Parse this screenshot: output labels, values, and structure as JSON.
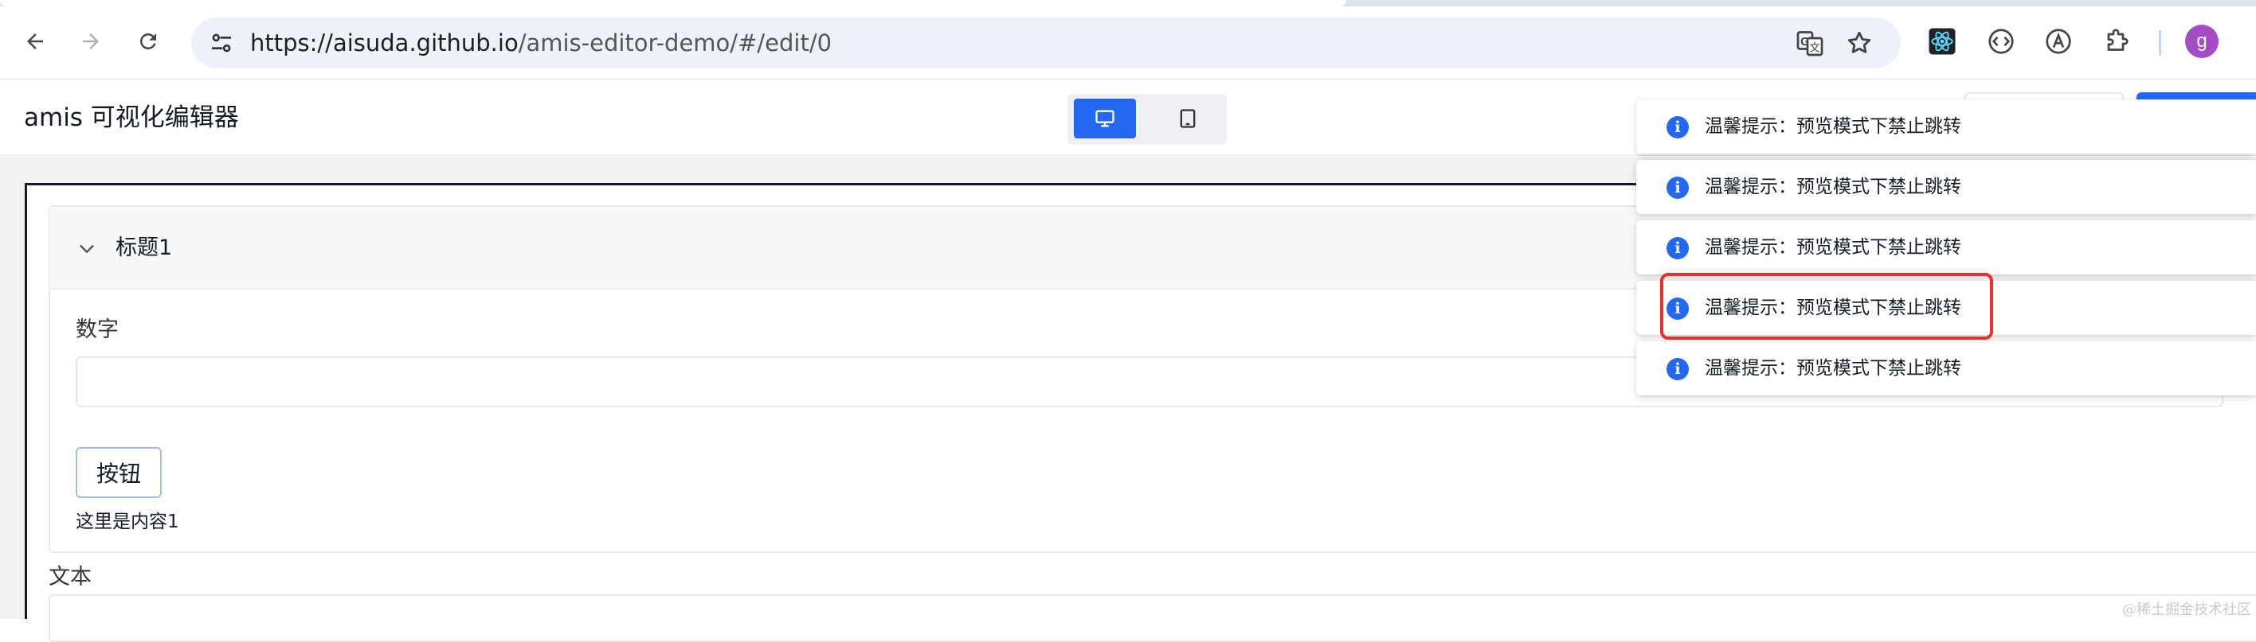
{
  "browser": {
    "url_host": "https://aisuda.github.io",
    "url_path": "/amis-editor-demo/#/edit/0",
    "avatar_letter": "g",
    "icons": [
      "back-icon",
      "forward-icon",
      "reload-icon",
      "site-info-icon",
      "translate-icon",
      "star-icon",
      "react-devtools-icon",
      "code-extension-icon",
      "font-extension-icon",
      "extensions-puzzle-icon"
    ]
  },
  "app": {
    "title": "amis 可视化编辑器",
    "device_modes": [
      "desktop",
      "mobile"
    ],
    "active_device": "desktop",
    "accent_color": "#2468f2"
  },
  "preview": {
    "collapse_title": "标题1",
    "number_label": "数字",
    "button_label": "按钮",
    "content_text": "这里是内容1",
    "text_label": "文本"
  },
  "toasts": [
    {
      "message": "温馨提示：预览模式下禁止跳转"
    },
    {
      "message": "温馨提示：预览模式下禁止跳转"
    },
    {
      "message": "温馨提示：预览模式下禁止跳转"
    },
    {
      "message": "温馨提示：预览模式下禁止跳转"
    },
    {
      "message": "温馨提示：预览模式下禁止跳转"
    }
  ],
  "highlight_color": "#e5322d",
  "watermark": "@稀土掘金技术社区"
}
